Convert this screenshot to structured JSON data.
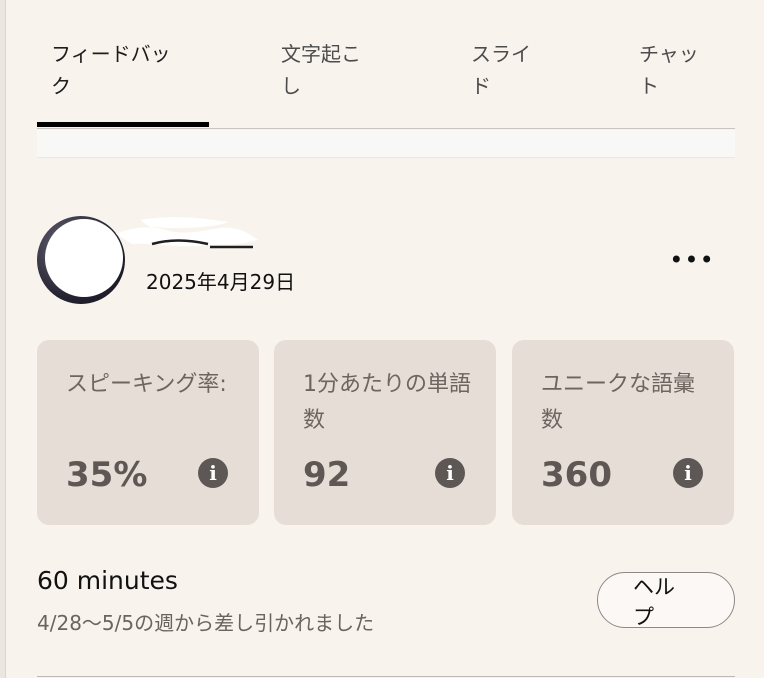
{
  "tabs": [
    {
      "label": "フィードバック",
      "active": true
    },
    {
      "label": "文字起こし",
      "active": false
    },
    {
      "label": "スライド",
      "active": false
    },
    {
      "label": "チャット",
      "active": false
    }
  ],
  "profile": {
    "date": "2025年4月29日",
    "more_label": "•••"
  },
  "metrics": [
    {
      "label": "スピーキング率:",
      "value": "35%"
    },
    {
      "label": "1分あたりの単語数",
      "value": "92"
    },
    {
      "label": "ユニークな語彙数",
      "value": "360"
    }
  ],
  "usage": {
    "minutes": "60 minutes",
    "note": "4/28〜5/5の週から差し引かれました",
    "help_label": "ヘルプ"
  },
  "icons": {
    "info": "info-icon",
    "more": "more-icon"
  },
  "colors": {
    "background": "#f8f3ed",
    "card": "#e6ddd7",
    "active_tab_indicator": "#000000"
  }
}
